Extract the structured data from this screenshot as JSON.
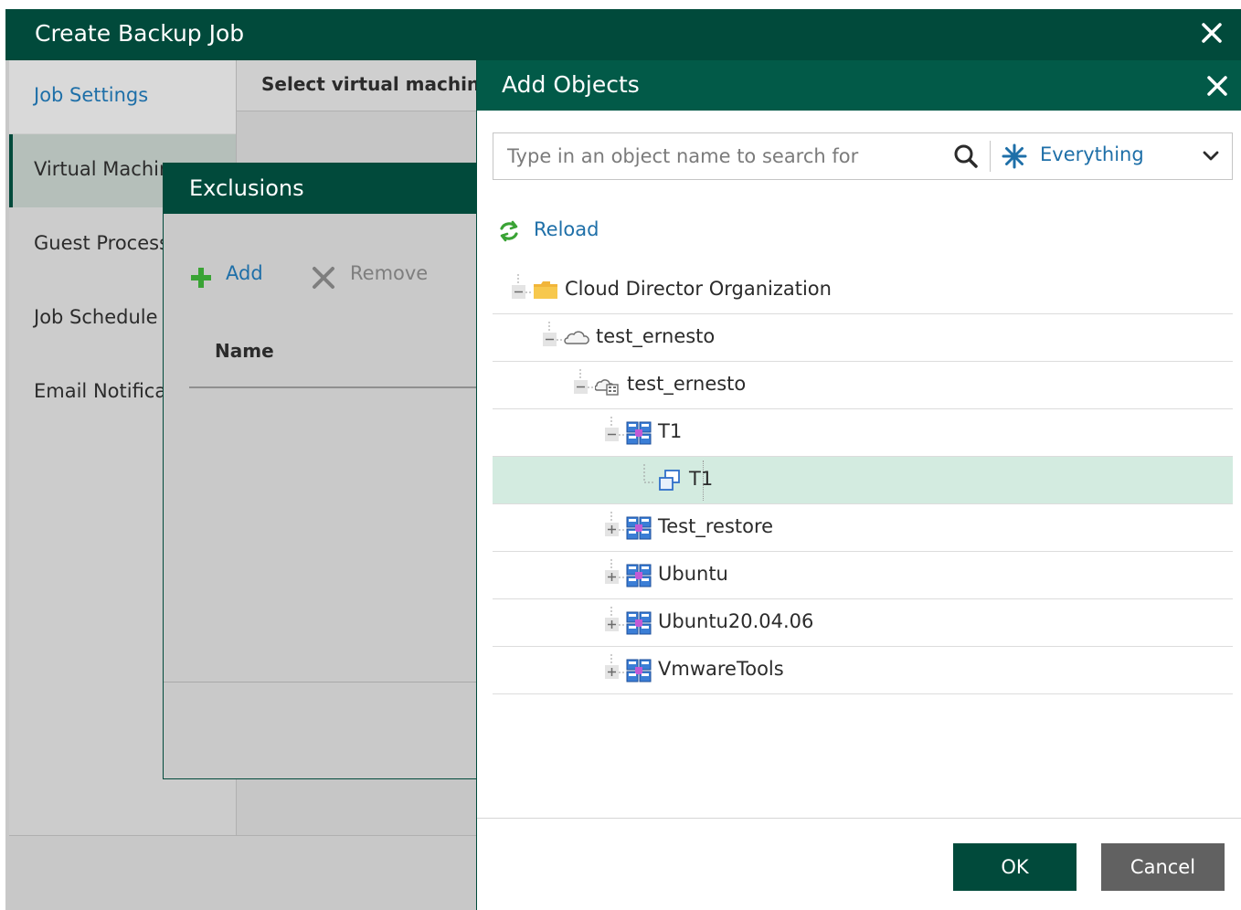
{
  "main_window": {
    "title": "Create Backup Job",
    "nav": [
      "Job Settings",
      "Virtual Machir",
      "Guest Process",
      "Job Schedule",
      "Email Notifica"
    ],
    "content_header": "Select virtual machin"
  },
  "exclusions": {
    "title": "Exclusions",
    "add_label": "Add",
    "remove_label": "Remove",
    "name_column": "Name"
  },
  "add_objects": {
    "title": "Add Objects",
    "search_placeholder": "Type in an object name to search for",
    "filter_label": "Everything",
    "reload_label": "Reload",
    "tree": [
      {
        "label": "Cloud Director Organization",
        "icon": "folder-icon",
        "level": 0,
        "expand": "collapse"
      },
      {
        "label": "test_ernesto",
        "icon": "cloud-icon",
        "level": 1,
        "expand": "collapse"
      },
      {
        "label": "test_ernesto",
        "icon": "cloud-datacenter-icon",
        "level": 2,
        "expand": "collapse"
      },
      {
        "label": "T1",
        "icon": "vapp-icon",
        "level": 3,
        "expand": "collapse"
      },
      {
        "label": "T1",
        "icon": "vm-icon",
        "level": 4,
        "expand": "none",
        "selected": true
      },
      {
        "label": "Test_restore",
        "icon": "vapp-icon",
        "level": 3,
        "expand": "expand"
      },
      {
        "label": "Ubuntu",
        "icon": "vapp-icon",
        "level": 3,
        "expand": "expand"
      },
      {
        "label": "Ubuntu20.04.06",
        "icon": "vapp-icon",
        "level": 3,
        "expand": "expand"
      },
      {
        "label": "VmwareTools",
        "icon": "vapp-icon",
        "level": 3,
        "expand": "expand"
      }
    ],
    "ok_label": "OK",
    "cancel_label": "Cancel"
  },
  "colors": {
    "header_dark": "#014a3b",
    "header_dialog": "#025a48",
    "link_blue": "#1e6fa8",
    "selected_row": "#d3ebe0",
    "add_green": "#3aa335"
  }
}
